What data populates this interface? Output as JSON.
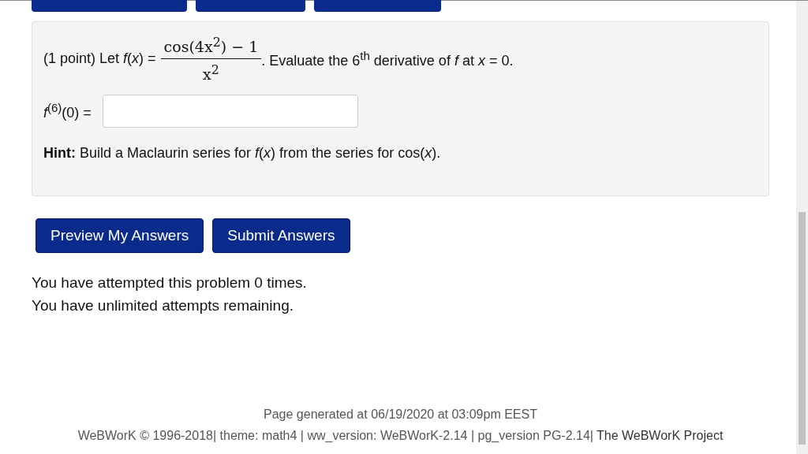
{
  "problem": {
    "intro": "(1 point) Let *f*(*x*) =",
    "numerator": "cos(4x$^{2}$) − 1",
    "denominator": "x$^{2}$",
    "rest": ". Evaluate the 6$^{th}$ derivative of *f* at *x* = 0.",
    "answer_label": "*f*$^{(6)}$(0) =",
    "hint": "**Hint:** Build a Maclaurin series for *f*(*x*) from the series for cos(*x*)."
  },
  "buttons": [
    "Preview My Answers",
    "Submit Answers"
  ],
  "messages": [
    "You have attempted this problem 0 times.",
    "You have unlimited attempts remaining."
  ],
  "footer": {
    "generated": "Page generated at 06/19/2020 at 03:09pm EEST",
    "credits": "WeBWorK © 1996-2018| theme: math4 | ww_version: WeBWorK-2.14 | pg_version PG-2.14|",
    "link": "The WeBWorK Project"
  }
}
